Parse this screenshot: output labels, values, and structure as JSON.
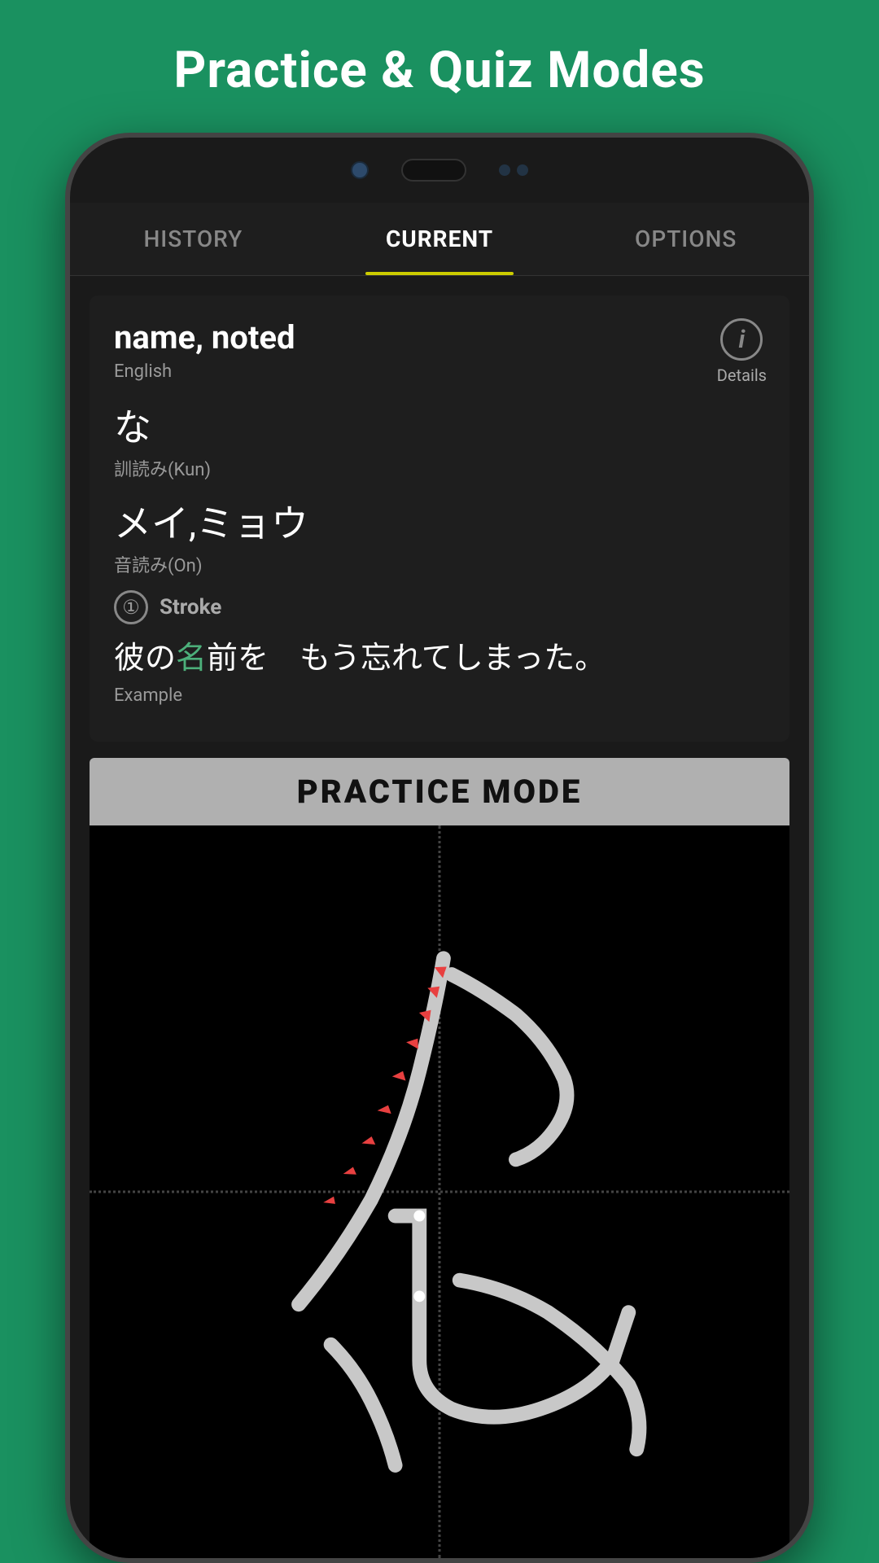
{
  "page": {
    "title": "Practice & Quiz Modes",
    "background_color": "#1a9160"
  },
  "tabs": {
    "items": [
      {
        "id": "history",
        "label": "HISTORY",
        "active": false
      },
      {
        "id": "current",
        "label": "CURRENT",
        "active": true
      },
      {
        "id": "options",
        "label": "OPTIONS",
        "active": false
      }
    ],
    "underline_color": "#cccc00"
  },
  "card": {
    "main_word": "name, noted",
    "lang_label": "English",
    "details_label": "Details",
    "kun_reading": "な",
    "kun_label": "訓読み(Kun)",
    "on_reading": "メイ,ミョウ",
    "on_label": "音読み(On)",
    "stroke_number": "①",
    "stroke_label": "Stroke",
    "example_text_before": "彼の",
    "example_kanji_highlight": "名",
    "example_text_after": "前を　もう忘れてしまった。",
    "example_label": "Example"
  },
  "practice": {
    "title": "PRACTICE MODE"
  }
}
